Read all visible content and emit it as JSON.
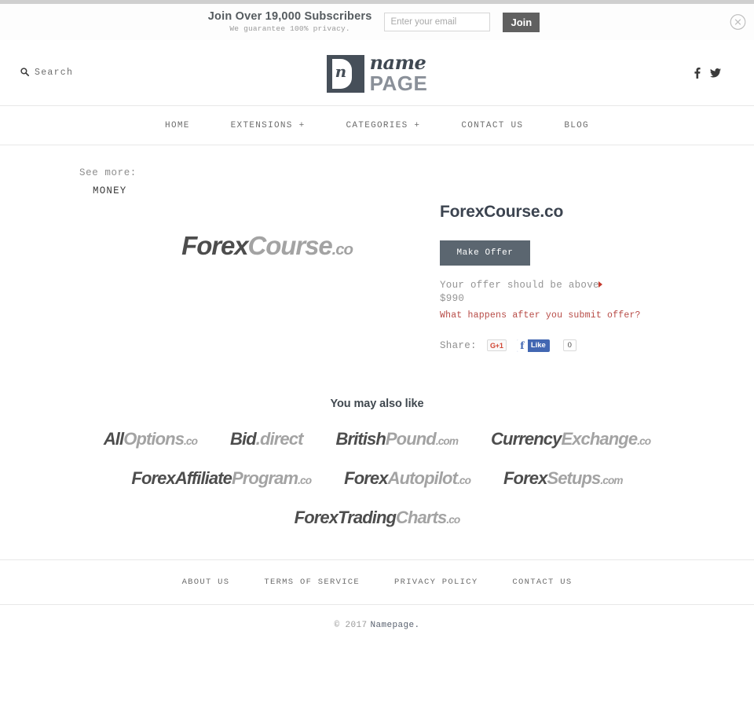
{
  "newsletter": {
    "headline": "Join Over 19,000 Subscribers",
    "subline": "We guarantee 100% privacy.",
    "email_placeholder": "Enter your email",
    "email_value": "",
    "join_label": "Join",
    "close_icon": "close-circle-icon"
  },
  "header": {
    "search_label": "Search",
    "search_icon": "search-icon",
    "logo": {
      "mark_letter": "n",
      "word_script": "name",
      "word_bold": "PAGE"
    },
    "social": [
      {
        "name": "facebook-icon",
        "glyph": "f"
      },
      {
        "name": "twitter-icon",
        "glyph": "t"
      }
    ]
  },
  "nav": {
    "items": [
      {
        "label": "HOME"
      },
      {
        "label": "EXTENSIONS +"
      },
      {
        "label": "CATEGORIES +"
      },
      {
        "label": "CONTACT US"
      },
      {
        "label": "BLOG"
      }
    ]
  },
  "see_more": {
    "label": "See more:",
    "category": "MONEY"
  },
  "product": {
    "logo": {
      "first": "Forex",
      "second": "Course",
      "tld": ".co"
    },
    "title": "ForexCourse.co",
    "make_offer_label": "Make Offer",
    "offer_note_line1": "Your offer should be above",
    "offer_note_line2": "$990",
    "offer_link": "What happens after you submit offer?",
    "share_label": "Share:",
    "gplus_label": "G+1",
    "fb_like_label": "Like",
    "fb_count": "0"
  },
  "also_like": {
    "title": "You may also like",
    "rows": [
      [
        {
          "first": "All",
          "second": "Options",
          "tld": ".co"
        },
        {
          "first": "Bid",
          "second": ".direct",
          "tld": ""
        },
        {
          "first": "British",
          "second": "Pound",
          "tld": ".com"
        },
        {
          "first": "Currency",
          "second": "Exchange",
          "tld": ".co"
        }
      ],
      [
        {
          "first": "ForexAffiliate",
          "second": "Program",
          "tld": ".co"
        },
        {
          "first": "Forex",
          "second": "Autopilot",
          "tld": ".co"
        },
        {
          "first": "Forex",
          "second": "Setups",
          "tld": ".com"
        }
      ],
      [
        {
          "first": "ForexTrading",
          "second": "Charts",
          "tld": ".co"
        }
      ]
    ]
  },
  "footer": {
    "links": [
      {
        "label": "ABOUT US"
      },
      {
        "label": "TERMS OF SERVICE"
      },
      {
        "label": "PRIVACY POLICY"
      },
      {
        "label": "CONTACT US"
      }
    ],
    "copyright_year": "© 2017",
    "copyright_name": "Namepage."
  },
  "colors": {
    "accent_slate": "#5b6670",
    "link_red": "#b74a45",
    "arrow_red": "#c43a2e",
    "logo_dark": "#4d4d4d",
    "logo_light": "#a3a3a3",
    "join_button": "#606060",
    "facebook_blue": "#4267b2",
    "gplus_red": "#d14836"
  }
}
